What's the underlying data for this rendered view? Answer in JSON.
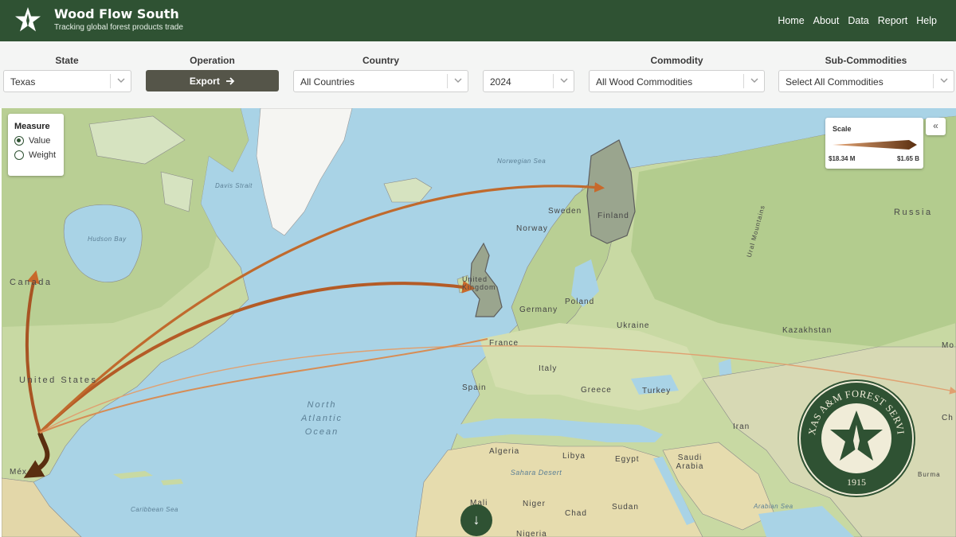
{
  "header": {
    "title": "Wood Flow South",
    "subtitle": "Tracking global forest products trade",
    "nav": [
      "Home",
      "About",
      "Data",
      "Report",
      "Help"
    ]
  },
  "filters": {
    "state": {
      "label": "State",
      "value": "Texas"
    },
    "operation": {
      "label": "Operation",
      "button": "Export",
      "icon": "arrow-right-icon"
    },
    "country": {
      "label": "Country",
      "value": "All Countries"
    },
    "year": {
      "value": "2024"
    },
    "commodity": {
      "label": "Commodity",
      "value": "All Wood Commodities"
    },
    "subcommodities": {
      "label": "Sub-Commodities",
      "value": "Select All Commodities"
    }
  },
  "measure": {
    "title": "Measure",
    "options": [
      {
        "label": "Value",
        "selected": true
      },
      {
        "label": "Weight",
        "selected": false
      }
    ]
  },
  "scale": {
    "title": "Scale",
    "min": "$18.34 M",
    "max": "$1.65 B"
  },
  "collapse_icon": "«",
  "down_icon": "↓",
  "map_labels": {
    "canada": "Canada",
    "united_states": "United States",
    "mexico": "Méx",
    "hudson_bay": "Hudson Bay",
    "davis_strait": "Davis Strait",
    "norwegian_sea": "Norwegian Sea",
    "north_atlantic": "North Atlantic Ocean",
    "caribbean_sea": "Caribbean Sea",
    "sweden": "Sweden",
    "norway": "Norway",
    "finland": "Finland",
    "russia": "Russia",
    "ural": "Ural Mountains",
    "united_kingdom": "United Kingdom",
    "germany": "Germany",
    "poland": "Poland",
    "ukraine": "Ukraine",
    "france": "France",
    "kazakhstan": "Kazakhstan",
    "spain": "Spain",
    "italy": "Italy",
    "greece": "Greece",
    "turkey": "Turkey",
    "iran": "Iran",
    "algeria": "Algeria",
    "libya": "Libya",
    "egypt": "Egypt",
    "sahara": "Sahara Desert",
    "saudi_arabia": "Saudi Arabia",
    "mali": "Mali",
    "niger": "Niger",
    "chad": "Chad",
    "sudan": "Sudan",
    "nigeria": "Nigeria",
    "arabian_sea": "Arabian Sea",
    "burma": "Burma",
    "mo": "Mo",
    "ch": "Ch"
  },
  "seal": {
    "text": "TEXAS A&M FOREST SERVICE",
    "year": "1915"
  },
  "flows": [
    {
      "from": "Texas",
      "to": "Mexico",
      "rank": "largest"
    },
    {
      "from": "Texas",
      "to": "Canada",
      "rank": "large"
    },
    {
      "from": "Texas",
      "to": "United Kingdom",
      "rank": "medium"
    },
    {
      "from": "Texas",
      "to": "Finland",
      "rank": "medium"
    },
    {
      "from": "Texas",
      "to": "China",
      "rank": "small"
    }
  ]
}
